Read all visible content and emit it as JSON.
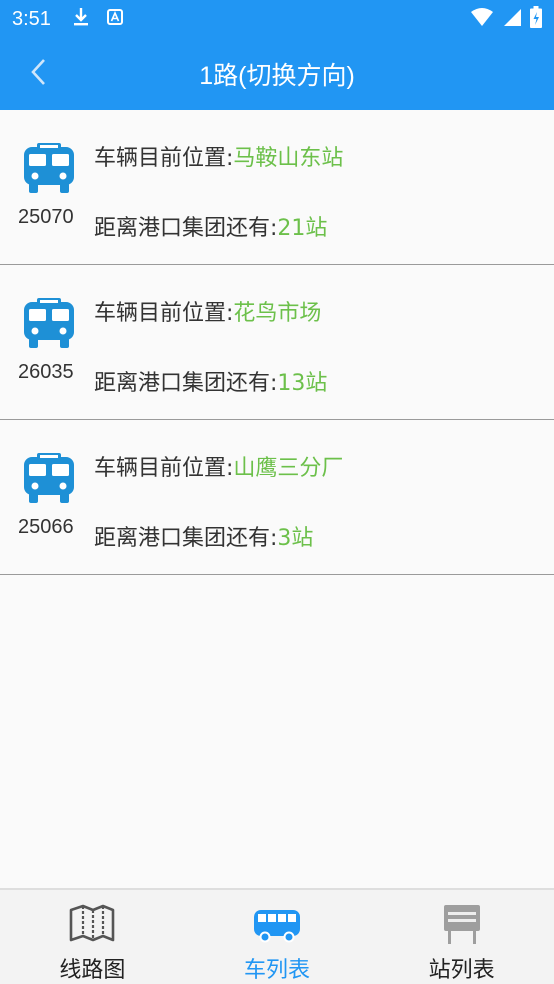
{
  "status_bar": {
    "time": "3:51"
  },
  "app_bar": {
    "title": "1路(切换方向)"
  },
  "buses": [
    {
      "number": "25070",
      "location_label": "车辆目前位置:",
      "location": "马鞍山东站",
      "distance_label": "距离港口集团还有:",
      "distance": "21站"
    },
    {
      "number": "26035",
      "location_label": "车辆目前位置:",
      "location": "花鸟市场",
      "distance_label": "距离港口集团还有:",
      "distance": "13站"
    },
    {
      "number": "25066",
      "location_label": "车辆目前位置:",
      "location": "山鹰三分厂",
      "distance_label": "距离港口集团还有:",
      "distance": "3站"
    }
  ],
  "bottom_nav": {
    "items": [
      {
        "label": "线路图",
        "icon": "map-icon",
        "active": false
      },
      {
        "label": "车列表",
        "icon": "bus-icon",
        "active": true
      },
      {
        "label": "站列表",
        "icon": "bus-stop-sign-icon",
        "active": false
      }
    ]
  },
  "colors": {
    "primary": "#2196f3",
    "accent_green": "#6cc04a",
    "bus_icon": "#1e90d6"
  }
}
